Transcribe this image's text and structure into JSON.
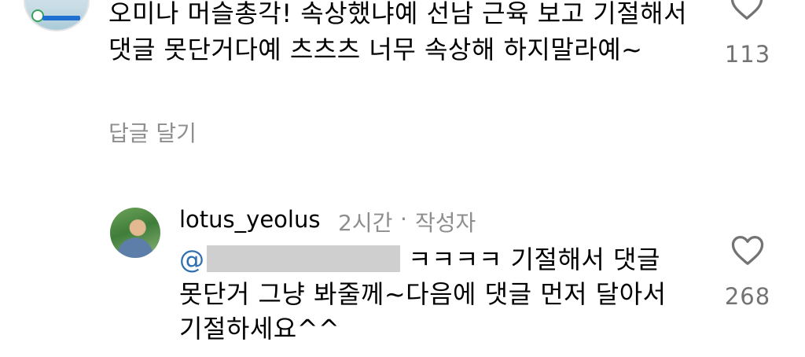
{
  "comment": {
    "body": "오미나 머슬총각! 속상했냐예 선남 근육 보고 기절해서 댓글 못단거다예 츠츠츠 너무 속상해 하지말라예~",
    "like_count": "113",
    "reply_action": "답글 달기"
  },
  "reply": {
    "username": "lotus_yeolus",
    "time": "2시간",
    "separator": "·",
    "author_badge": "작성자",
    "mention_prefix": "@",
    "mention_tail": "ㅋㅋㅋㅋ 기절해서 댓글",
    "body_rest": "못단거 그냥 봐줄께~다음에 댓글 먼저 달아서 기절하세요^^",
    "like_count": "268"
  },
  "colors": {
    "secondary_text": "#8e8e8e",
    "like_count": "#737373",
    "mention": "#2f6fb0",
    "redaction": "#cfcfcf"
  }
}
